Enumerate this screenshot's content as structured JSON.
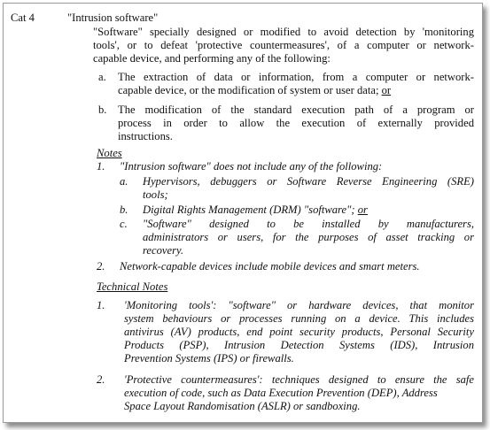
{
  "category": "Cat 4",
  "term": "\"Intrusion software\"",
  "definition": {
    "line1": "\"Software\" specially designed or modified to avoid detection by 'monitoring",
    "line2": "tools', or to defeat 'protective countermeasures', of a computer or network-",
    "line3": "capable device, and performing any of the following:"
  },
  "items": [
    {
      "marker": "a.",
      "line1": "The extraction of data or information, from a computer or network-",
      "line2_text": "capable device, or the modification of system or user data; ",
      "line2_or": "or"
    },
    {
      "marker": "b.",
      "line1": "The modification of the standard execution path of a program or",
      "line2": "process in order to allow the execution of externally provided",
      "line3": "instructions."
    }
  ],
  "notes": {
    "heading": "Notes",
    "note1": {
      "marker": "1.",
      "text": "\"Intrusion software\" does not include any of the following:",
      "sub": [
        {
          "marker": "a.",
          "line1": "Hypervisors, debuggers or Software Reverse Engineering (SRE)",
          "line2": "tools;"
        },
        {
          "marker": "b.",
          "text": "Digital Rights Management (DRM) \"software\"; ",
          "or": "or"
        },
        {
          "marker": "c.",
          "line1": "\"Software\" designed to be installed by manufacturers,",
          "line2": "administrators or users, for the purposes of asset tracking or",
          "line3": "recovery."
        }
      ]
    },
    "note2": {
      "marker": "2.",
      "text": "Network-capable devices include mobile devices and smart meters."
    }
  },
  "technical_notes": {
    "heading": "Technical Notes",
    "note1": {
      "marker": "1.",
      "line1": "'Monitoring tools': \"software\" or hardware devices, that monitor",
      "line2": "system behaviours or processes running on a device.  This includes",
      "line3": "antivirus (AV) products, end point security products, Personal Security",
      "line4": "Products (PSP), Intrusion Detection Systems (IDS), Intrusion",
      "line5": "Prevention Systems (IPS) or firewalls."
    },
    "note2": {
      "marker": "2.",
      "line1": "'Protective countermeasures': techniques designed to ensure the safe",
      "line2": "execution of code, such as Data Execution Prevention (DEP), Address",
      "line3": "Space Layout Randomisation (ASLR) or sandboxing."
    }
  }
}
